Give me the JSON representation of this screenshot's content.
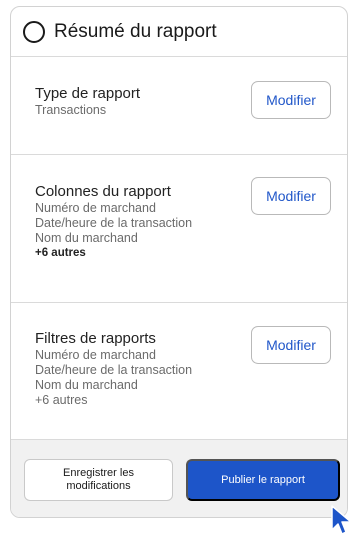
{
  "header": {
    "title": "Résumé du rapport",
    "icon": "circle-icon"
  },
  "sections": [
    {
      "title": "Type de rapport",
      "lines": [
        "Transactions"
      ],
      "more": "",
      "button": "Modifier"
    },
    {
      "title": "Colonnes du rapport",
      "lines": [
        "Numéro de marchand",
        "Date/heure de la transaction",
        "Nom du marchand"
      ],
      "more": "+6 autres",
      "button": "Modifier"
    },
    {
      "title": "Filtres de rapports",
      "lines": [
        "Numéro de marchand",
        "Date/heure de la transaction",
        "Nom du marchand"
      ],
      "more": "+6 autres",
      "button": "Modifier"
    }
  ],
  "footer": {
    "save_label_line1": "Enregistrer les",
    "save_label_line2": "modifications",
    "publish_label": "Publier le rapport"
  },
  "colors": {
    "accent": "#1d55c9",
    "link": "#2157c9",
    "footer_bg": "#f1f1f1"
  },
  "cursor_icon": "mouse-pointer-icon"
}
